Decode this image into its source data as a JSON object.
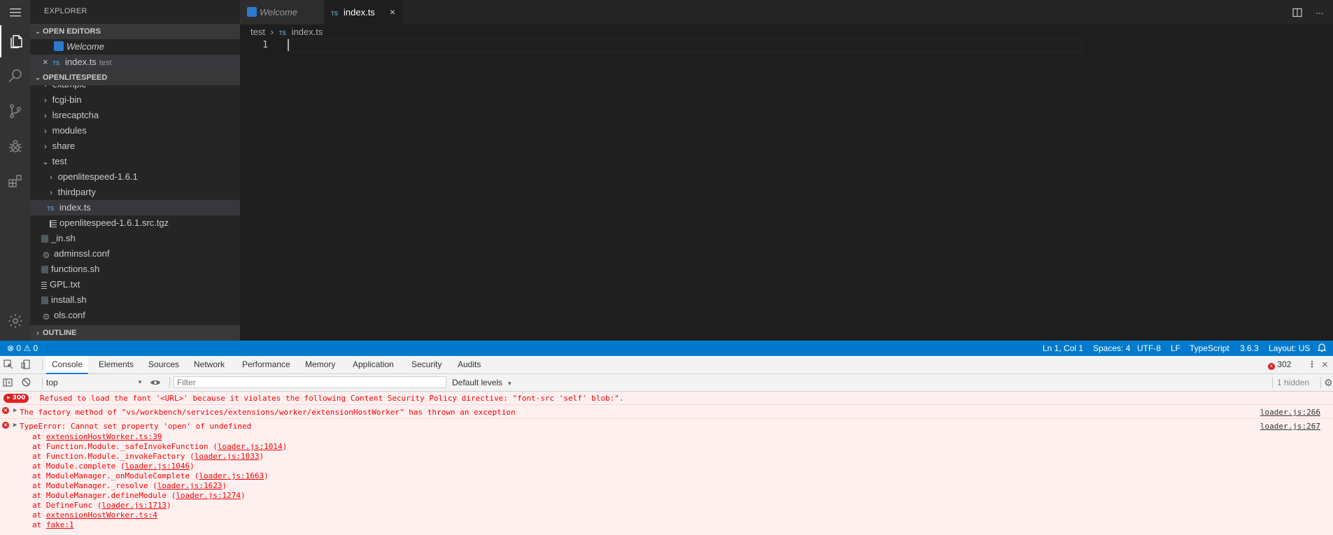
{
  "colors": {
    "activity_bar": "#333333",
    "sidebar": "#252526",
    "editor": "#1e1e1e",
    "statusbar": "#007acc",
    "console_error_bg": "#fff0f0",
    "error_text": "#ff0000"
  },
  "activity_bar": {
    "icons": [
      "menu-icon",
      "files-icon",
      "search-icon",
      "source-control-icon",
      "debug-icon",
      "extensions-icon",
      "gear-icon"
    ]
  },
  "sidebar": {
    "title": "EXPLORER",
    "open_editors_header": "OPEN EDITORS",
    "open_editors": [
      {
        "name": "Welcome",
        "desc": ""
      },
      {
        "name": "index.ts",
        "desc": "test",
        "badge": "TS"
      }
    ],
    "folder_header": "OPENLITESPEED",
    "tree": [
      {
        "name": "example",
        "type": "folder"
      },
      {
        "name": "fcgi-bin",
        "type": "folder"
      },
      {
        "name": "lsrecaptcha",
        "type": "folder"
      },
      {
        "name": "modules",
        "type": "folder"
      },
      {
        "name": "share",
        "type": "folder"
      },
      {
        "name": "test",
        "type": "folder-open"
      },
      {
        "name": "openlitespeed-1.6.1",
        "type": "folder"
      },
      {
        "name": "thirdparty",
        "type": "folder"
      },
      {
        "name": "index.ts",
        "type": "ts",
        "badge": "TS"
      },
      {
        "name": "openlitespeed-1.6.1.src.tgz",
        "type": "file"
      },
      {
        "name": "_in.sh",
        "type": "shell"
      },
      {
        "name": "adminssl.conf",
        "type": "gear"
      },
      {
        "name": "functions.sh",
        "type": "shell"
      },
      {
        "name": "GPL.txt",
        "type": "file"
      },
      {
        "name": "install.sh",
        "type": "shell"
      },
      {
        "name": "ols.conf",
        "type": "gear"
      }
    ],
    "outline_header": "OUTLINE"
  },
  "editor": {
    "tabs": [
      {
        "label": "Welcome",
        "active": false
      },
      {
        "label": "index.ts",
        "active": true,
        "badge": "TS",
        "close": "×"
      }
    ],
    "breadcrumb": {
      "folder": "test",
      "sep": "›",
      "badge": "TS",
      "file": "index.ts"
    },
    "line_number": "1",
    "more_icon": "···"
  },
  "statusbar": {
    "errors": "0",
    "warnings": "0",
    "position": "Ln 1, Col 1",
    "spaces": "Spaces: 4",
    "encoding": "UTF-8",
    "eol": "LF",
    "language": "TypeScript",
    "version": "3.6.3",
    "layout": "Layout: US"
  },
  "devtools": {
    "tabs": [
      "Console",
      "Elements",
      "Sources",
      "Network",
      "Performance",
      "Memory",
      "Application",
      "Security",
      "Audits"
    ],
    "error_count": "302",
    "context": "top",
    "filter_placeholder": "Filter",
    "levels": "Default levels",
    "hidden": "1 hidden",
    "messages": [
      {
        "badge": "300",
        "text": "Refused to load the font '<URL>' because it violates the following Content Security Policy directive: \"font-src 'self' blob:\".",
        "source": ""
      },
      {
        "text": "The factory method of \"vs/workbench/services/extensions/worker/extensionHostWorker\" has thrown an exception",
        "source": "loader.js:266"
      },
      {
        "text": "TypeError: Cannot set property 'open' of undefined",
        "source": "loader.js:267",
        "stack": [
          {
            "fn": "at ",
            "link": "extensionHostWorker.ts:39",
            "paren": false
          },
          {
            "fn": "at Function.Module._safeInvokeFunction (",
            "link": "loader.js:1014",
            "paren": true
          },
          {
            "fn": "at Function.Module._invokeFactory (",
            "link": "loader.js:1033",
            "paren": true
          },
          {
            "fn": "at Module.complete (",
            "link": "loader.js:1046",
            "paren": true
          },
          {
            "fn": "at ModuleManager._onModuleComplete (",
            "link": "loader.js:1663",
            "paren": true
          },
          {
            "fn": "at ModuleManager._resolve (",
            "link": "loader.js:1623",
            "paren": true
          },
          {
            "fn": "at ModuleManager.defineModule (",
            "link": "loader.js:1274",
            "paren": true
          },
          {
            "fn": "at DefineFunc (",
            "link": "loader.js:1713",
            "paren": true
          },
          {
            "fn": "at ",
            "link": "extensionHostWorker.ts:4",
            "paren": false
          },
          {
            "fn": "at ",
            "link": "fake:1",
            "paren": false
          }
        ]
      }
    ]
  }
}
